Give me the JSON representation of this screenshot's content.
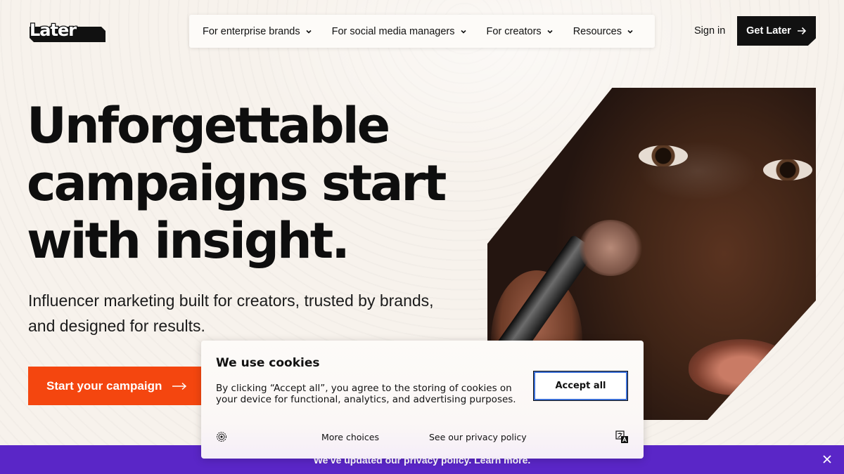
{
  "header": {
    "logo_text": "Later",
    "nav": [
      {
        "label": "For enterprise brands"
      },
      {
        "label": "For social media managers"
      },
      {
        "label": "For creators"
      },
      {
        "label": "Resources"
      }
    ],
    "sign_in": "Sign in",
    "cta": "Get Later"
  },
  "hero": {
    "title_lines": [
      "Unforgettable",
      "campaigns start",
      "with insight."
    ],
    "subtitle_lines": [
      "Influencer marketing built for creators, trusted by brands,",
      "and designed for results."
    ],
    "cta": "Start your campaign"
  },
  "banner": {
    "text": "We've updated our privacy policy. Learn more."
  },
  "cookie": {
    "title": "We use cookies",
    "text": "By clicking “Accept all”, you agree to the storing of cookies on your device for functional, analytics, and advertising purposes.",
    "accept": "Accept all",
    "more_choices": "More choices",
    "privacy": "See our privacy policy"
  },
  "colors": {
    "background": "#f7f2ec",
    "cta_orange": "#f4460f",
    "banner_purple": "#5a26c7",
    "dark": "#111111"
  },
  "icons": [
    "chevron-down-icon",
    "arrow-right-icon",
    "close-icon",
    "gear-icon",
    "translate-icon"
  ]
}
